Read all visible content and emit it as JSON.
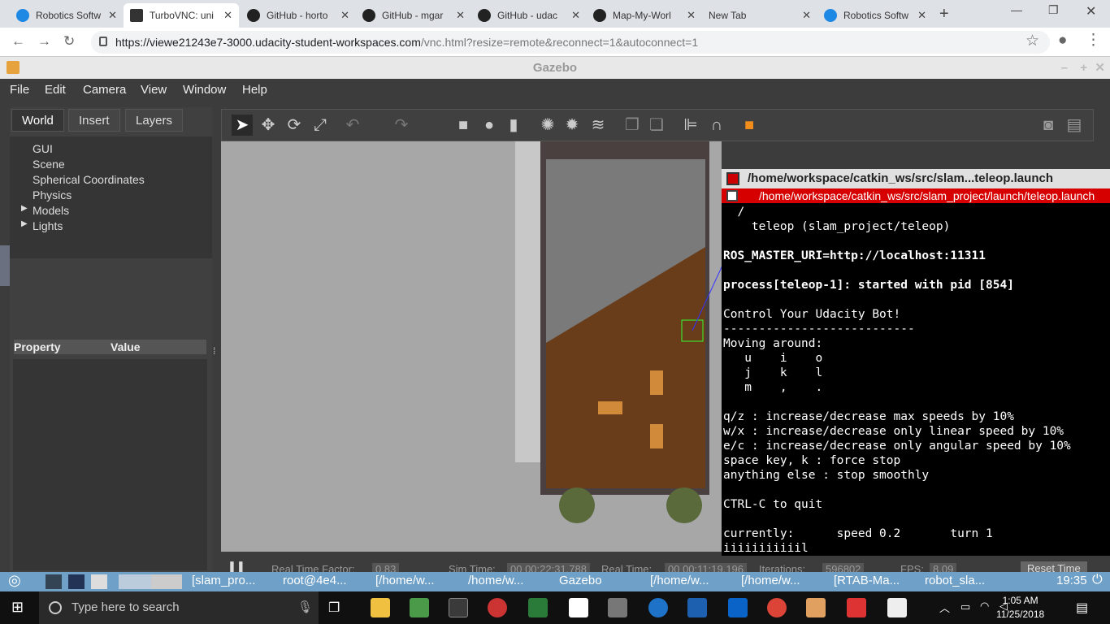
{
  "browser": {
    "tabs": [
      {
        "title": "Robotics Softw",
        "color": "#1e88e5"
      },
      {
        "title": "TurboVNC: uni",
        "color": "#222"
      },
      {
        "title": "GitHub - horto",
        "color": "#222"
      },
      {
        "title": "GitHub - mgar",
        "color": "#222"
      },
      {
        "title": "GitHub - udac",
        "color": "#222"
      },
      {
        "title": "Map-My-Worl",
        "color": "#222"
      },
      {
        "title": "New Tab",
        "color": ""
      },
      {
        "title": "Robotics Softw",
        "color": "#1e88e5"
      }
    ],
    "url_host": "https://viewe21243e7-3000.udacity-student-workspaces.com",
    "url_path": "/vnc.html?resize=remote&reconnect=1&autoconnect=1"
  },
  "gazebo": {
    "title": "Gazebo",
    "menu": [
      "File",
      "Edit",
      "Camera",
      "View",
      "Window",
      "Help"
    ],
    "left_tabs": [
      "World",
      "Insert",
      "Layers"
    ],
    "tree": [
      "GUI",
      "Scene",
      "Spherical Coordinates",
      "Physics",
      "Models",
      "Lights"
    ],
    "prop_header": {
      "property": "Property",
      "value": "Value"
    },
    "bottom": {
      "rtf_label": "Real Time Factor:",
      "rtf": "0.83",
      "sim_label": "Sim Time:",
      "sim": "00 00:22:31.788",
      "real_label": "Real Time:",
      "real": "00 00:11:19.196",
      "iter_label": "Iterations:",
      "iter": "596802",
      "fps_label": "FPS:",
      "fps": "8.09",
      "reset": "Reset Time"
    }
  },
  "terminal": {
    "title": "/home/workspace/catkin_ws/src/slam...teleop.launch",
    "subtitle": "/home/workspace/catkin_ws/src/slam_project/launch/teleop.launch",
    "lines": [
      "  /",
      "    teleop (slam_project/teleop)",
      "",
      "ROS_MASTER_URI=http://localhost:11311",
      "",
      "process[teleop-1]: started with pid [854]",
      "",
      "Control Your Udacity Bot!",
      "---------------------------",
      "Moving around:",
      "   u    i    o",
      "   j    k    l",
      "   m    ,    .",
      "",
      "q/z : increase/decrease max speeds by 10%",
      "w/x : increase/decrease only linear speed by 10%",
      "e/c : increase/decrease only angular speed by 10%",
      "space key, k : force stop",
      "anything else : stop smoothly",
      "",
      "CTRL-C to quit",
      "",
      "currently:      speed 0.2       turn 1",
      "iiiiiiiiiiil"
    ]
  },
  "xtaskbar": {
    "items": [
      "[slam_pro...",
      "root@4e4...",
      "[/home/w...",
      "/home/w...",
      "Gazebo",
      "[/home/w...",
      "[/home/w...",
      "[RTAB-Ma...",
      "robot_sla..."
    ],
    "time": "19:35"
  },
  "windows": {
    "search_placeholder": "Type here to search",
    "time": "1:05 AM",
    "date": "11/25/2018"
  }
}
